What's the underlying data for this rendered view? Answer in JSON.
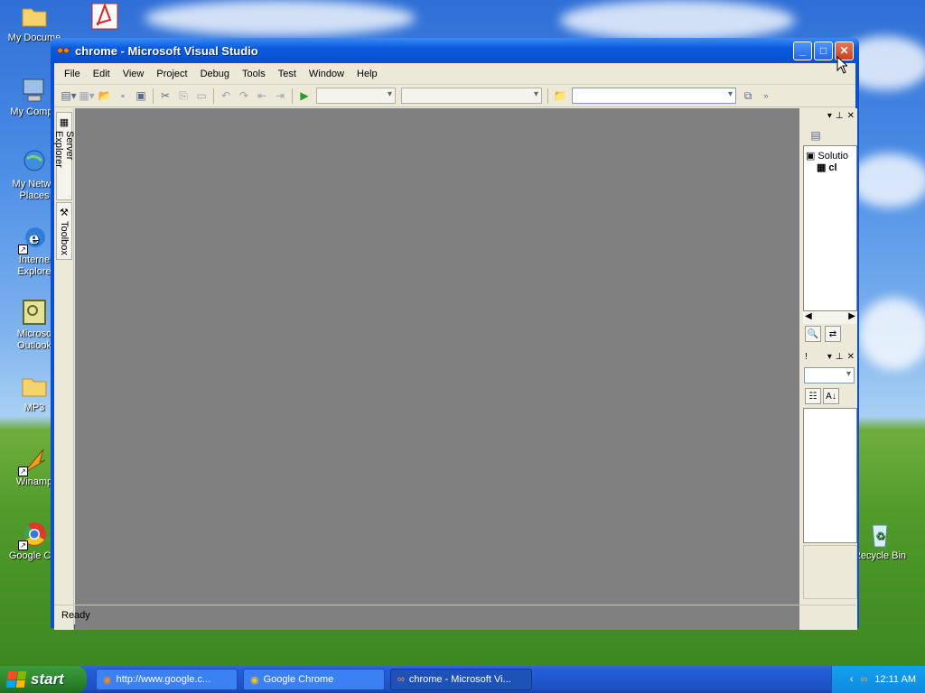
{
  "desktop": {
    "icons": [
      {
        "label": "My Docume"
      },
      {
        "label": "My Compu"
      },
      {
        "label": "My Netwo\nPlaces"
      },
      {
        "label": "Interne\nExplore"
      },
      {
        "label": "Microso\nOutlook"
      },
      {
        "label": "MP3"
      },
      {
        "label": "Winamp"
      },
      {
        "label": "Google Chr"
      },
      {
        "label": "Recycle Bin"
      }
    ]
  },
  "window": {
    "title": "chrome - Microsoft Visual Studio",
    "controls": {
      "minimize": "_",
      "maximize": "□",
      "close": "✕"
    },
    "menu": [
      "File",
      "Edit",
      "View",
      "Project",
      "Debug",
      "Tools",
      "Test",
      "Window",
      "Help"
    ],
    "side_tabs": {
      "server_explorer": "Server Explorer",
      "toolbox": "Toolbox"
    },
    "solution_panel": {
      "tree": {
        "root": "Solutio",
        "child": "cl"
      }
    },
    "properties_panel": {
      "title_fragment": "!"
    },
    "status": "Ready"
  },
  "taskbar": {
    "start_label": "start",
    "tasks": [
      {
        "label": "http://www.google.c..."
      },
      {
        "label": "Google Chrome"
      },
      {
        "label": "chrome - Microsoft Vi..."
      }
    ],
    "clock": "12:11 AM"
  },
  "colors": {
    "editor_bg": "#808080",
    "title_blue": "#0a5ae0",
    "taskbar_blue": "#245edb",
    "start_green": "#2f8a2f"
  }
}
